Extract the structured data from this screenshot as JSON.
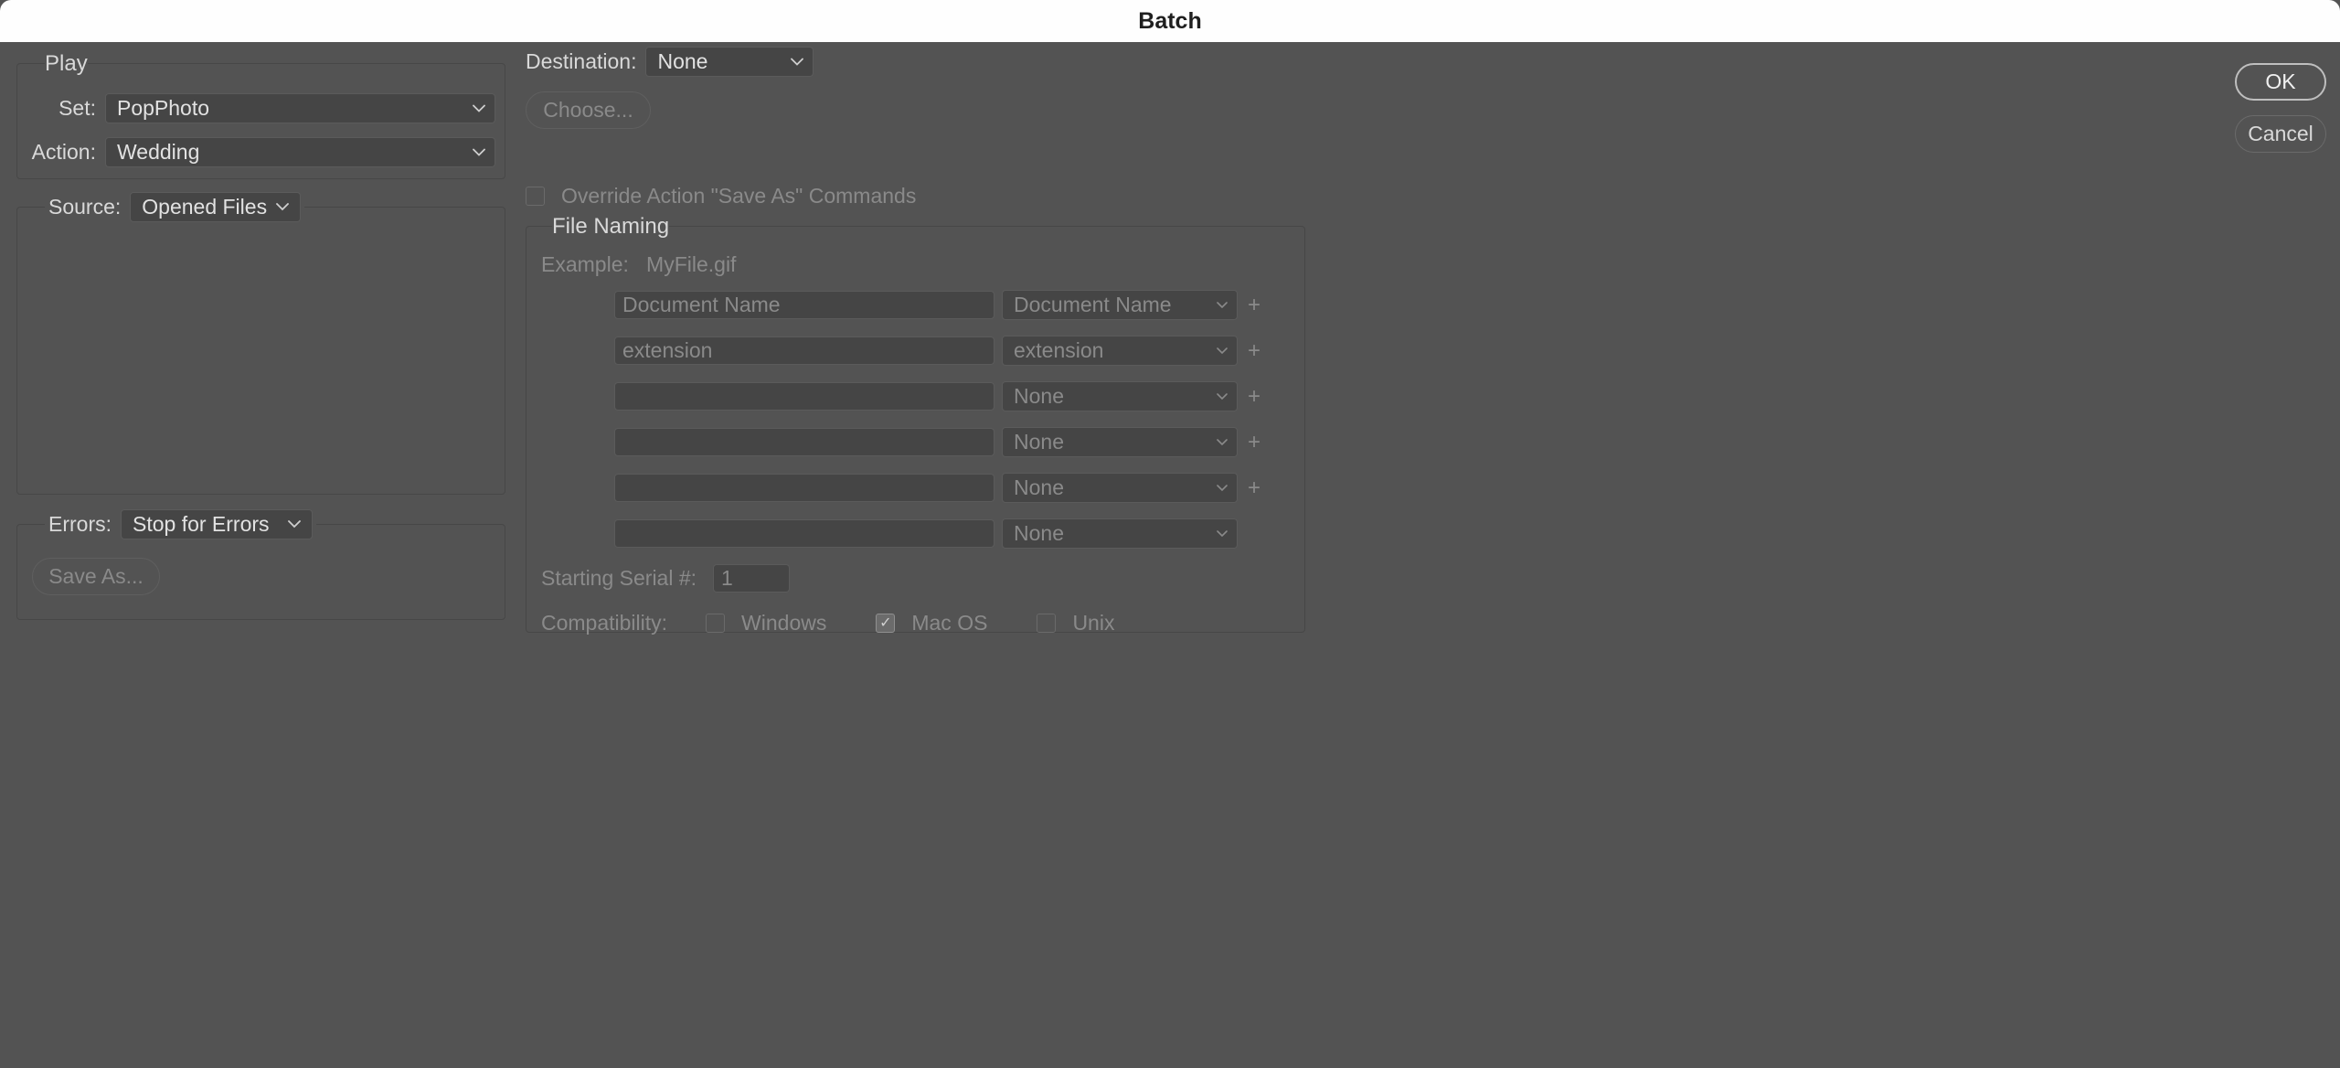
{
  "title": "Batch",
  "buttons": {
    "ok": "OK",
    "cancel": "Cancel"
  },
  "play": {
    "legend": "Play",
    "set_label": "Set:",
    "set_value": "PopPhoto",
    "action_label": "Action:",
    "action_value": "Wedding"
  },
  "source": {
    "label": "Source:",
    "value": "Opened Files"
  },
  "errors": {
    "label": "Errors:",
    "value": "Stop for Errors",
    "save_as": "Save As..."
  },
  "destination": {
    "label": "Destination:",
    "value": "None",
    "choose": "Choose..."
  },
  "override": {
    "label": "Override Action \"Save As\" Commands"
  },
  "naming": {
    "legend": "File Naming",
    "example_label": "Example:",
    "example_value": "MyFile.gif",
    "rows": [
      {
        "text": "Document Name",
        "sel": "Document Name",
        "plus": true
      },
      {
        "text": "extension",
        "sel": "extension",
        "plus": true
      },
      {
        "text": "",
        "sel": "None",
        "plus": true
      },
      {
        "text": "",
        "sel": "None",
        "plus": true
      },
      {
        "text": "",
        "sel": "None",
        "plus": true
      },
      {
        "text": "",
        "sel": "None",
        "plus": false
      }
    ],
    "serial_label": "Starting Serial #:",
    "serial_value": "1",
    "compat_label": "Compatibility:",
    "compat": {
      "windows": "Windows",
      "mac": "Mac OS",
      "unix": "Unix"
    }
  }
}
